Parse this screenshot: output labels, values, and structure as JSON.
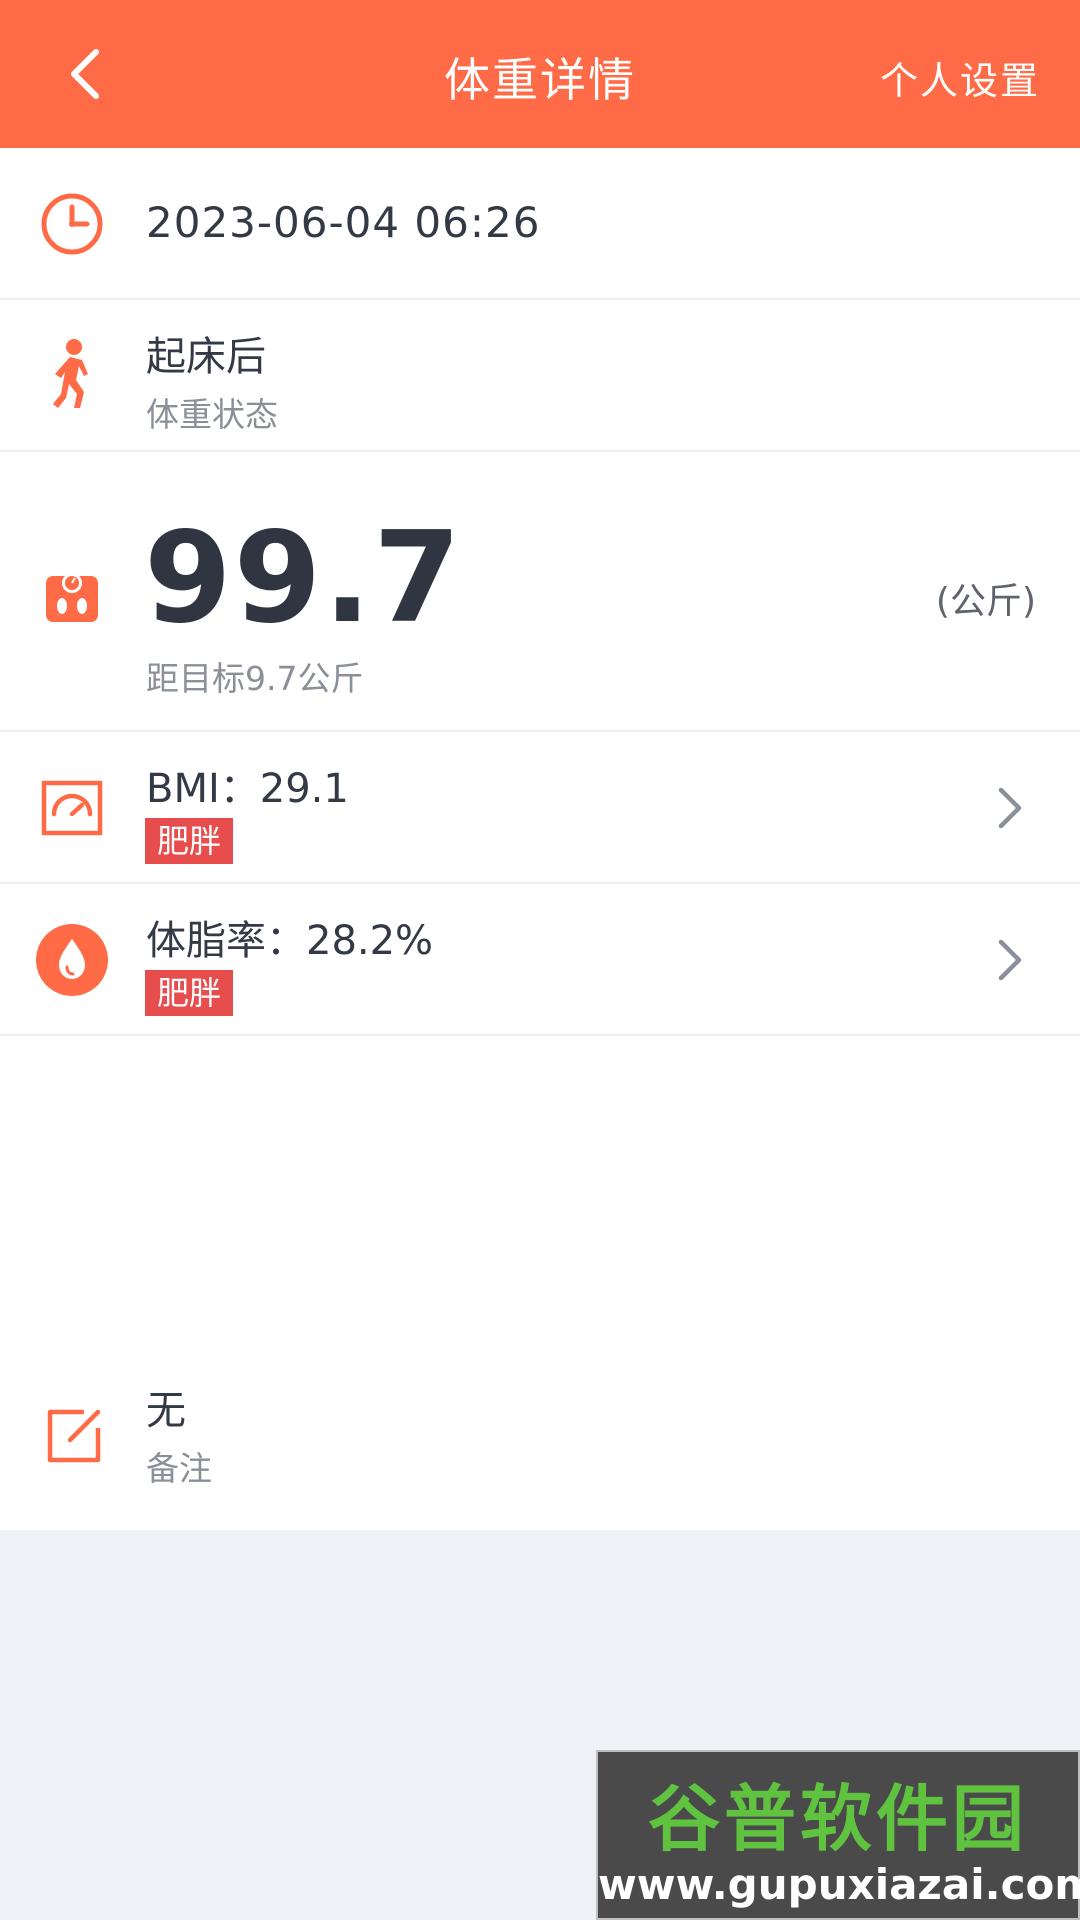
{
  "header": {
    "title": "体重详情",
    "right_action": "个人设置",
    "background_color": "#ff6b47"
  },
  "datetime": {
    "value": "2023-06-04 06:26",
    "icon": "clock-icon"
  },
  "state": {
    "value": "起床后",
    "label": "体重状态",
    "icon": "person-walk-icon"
  },
  "weight": {
    "value": "99.7",
    "unit": "(公斤)",
    "goal_text": "距目标9.7公斤",
    "icon": "scale-icon"
  },
  "bmi": {
    "label": "BMI：29.1",
    "badge": "肥胖",
    "icon": "gauge-icon"
  },
  "body_fat": {
    "label": "体脂率：28.2%",
    "badge": "肥胖",
    "icon": "water-drop-icon"
  },
  "note": {
    "value": "无",
    "label": "备注",
    "icon": "edit-icon"
  },
  "watermark": {
    "title": "谷普软件园",
    "url": "www.gupuxiazai.com"
  },
  "colors": {
    "accent": "#ff6b47",
    "badge": "#e84d4d",
    "page_bg": "#eef2f6"
  }
}
